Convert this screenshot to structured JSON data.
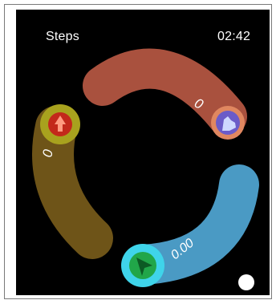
{
  "screen": {
    "title": "Steps",
    "time": "02:42"
  },
  "rings": [
    {
      "id": "steps",
      "icon": "shoe-icon",
      "value_label": "0",
      "progress": 0,
      "track_color": "#a9513e",
      "badge_ring_color": "#e08760",
      "badge_fill_color": "#6b5bc8",
      "icon_color": "#cfd8ff"
    },
    {
      "id": "calories",
      "icon": "flame-icon",
      "value_label": "0",
      "progress": 0,
      "track_color": "#6e5418",
      "badge_ring_color": "#a8a21e",
      "badge_fill_color": "#c3281b",
      "icon_color": "#ff9a80"
    },
    {
      "id": "distance",
      "icon": "navigation-arrow-icon",
      "value_label": "0.00",
      "progress": 0,
      "track_color": "#4a9ac4",
      "badge_ring_color": "#3fd4ea",
      "badge_fill_color": "#21a649",
      "icon_color": "#0c5a24"
    }
  ]
}
